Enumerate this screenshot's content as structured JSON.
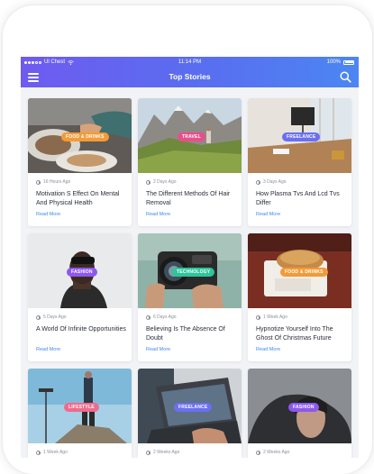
{
  "status_bar": {
    "carrier": "Ul Chest",
    "time": "11:14 PM",
    "battery": "100%"
  },
  "app_bar": {
    "title": "Top Stories",
    "menu_icon": "hamburger-menu-icon",
    "search_icon": "search-icon"
  },
  "read_more_label": "Read More",
  "colors": {
    "gradient_start": "#6f5bf0",
    "gradient_end": "#4b86f2",
    "link": "#3d8be8"
  },
  "stories": [
    {
      "category": "FOOD & DRINKS",
      "badge_color": "#f29b38",
      "time": "16 Hours Ago",
      "title": "Motivation S Effect On Mental And Physical Health"
    },
    {
      "category": "TRAVEL",
      "badge_color": "#e94e8a",
      "time": "2 Days Ago",
      "title": "The Different Methods Of Hair Removal"
    },
    {
      "category": "FREELANCE",
      "badge_color": "#6b6ff0",
      "time": "3 Days Ago",
      "title": "How Plasma Tvs And Lcd Tvs Differ"
    },
    {
      "category": "FASHION",
      "badge_color": "#8d58ee",
      "time": "5 Days Ago",
      "title": "A World Of Infinite Opportunities"
    },
    {
      "category": "TECHNOLOGY",
      "badge_color": "#2ec59a",
      "time": "6 Days Ago",
      "title": "Believing Is The Absence Of Doubt"
    },
    {
      "category": "FOOD & DRINKS",
      "badge_color": "#f29b38",
      "time": "1 Week Ago",
      "title": "Hypnotize Yourself Into The Ghost Of Christmas Future"
    },
    {
      "category": "LIFESTYLE",
      "badge_color": "#f06a8d",
      "time": "1 Week Ago",
      "title": ""
    },
    {
      "category": "FREELANCE",
      "badge_color": "#6b6ff0",
      "time": "2 Weeks Ago",
      "title": ""
    },
    {
      "category": "FASHION",
      "badge_color": "#8d58ee",
      "time": "2 Weeks Ago",
      "title": ""
    }
  ]
}
